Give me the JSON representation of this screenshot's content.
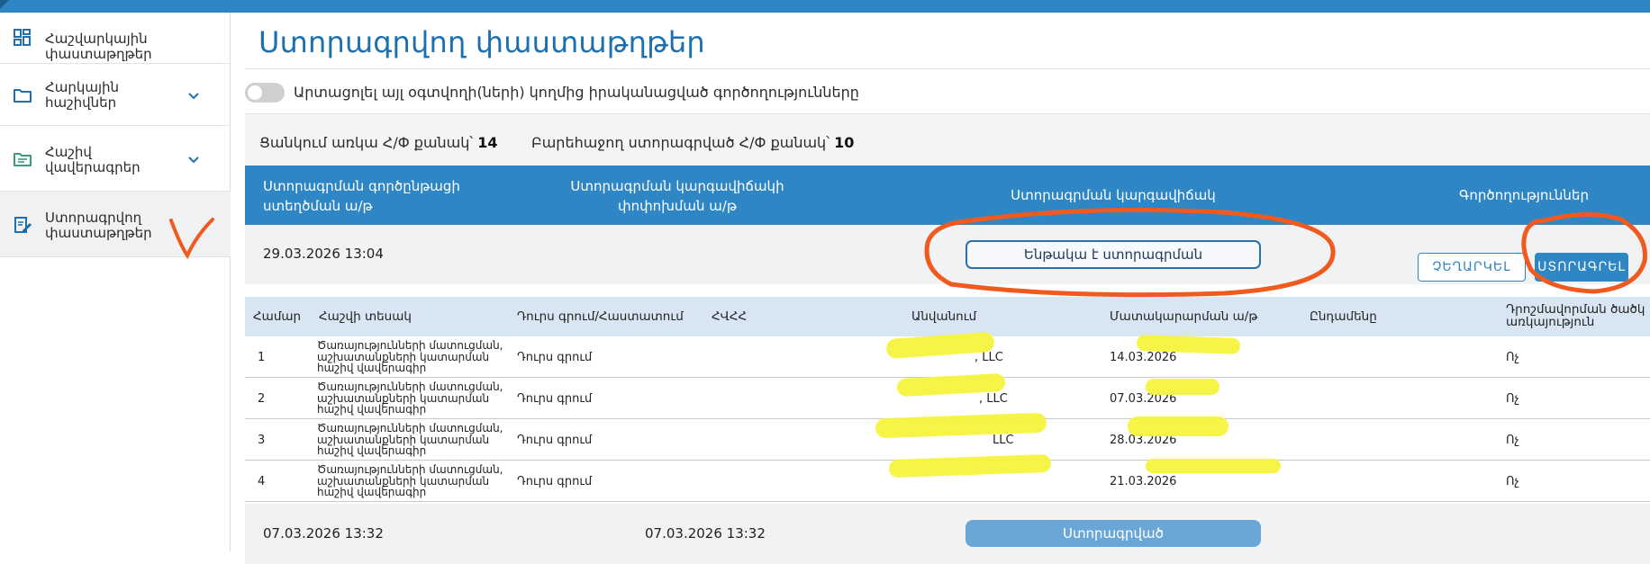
{
  "sidebar": {
    "items": [
      {
        "label": "Հաշվարկային փաստաթղթեր",
        "icon": "dashboard-icon"
      },
      {
        "label": "Հարկային հաշիվներ",
        "icon": "folder-icon"
      },
      {
        "label": "Հաշիվ վավերագրեր",
        "icon": "folder-doc-icon"
      },
      {
        "label": "Ստորագրվող փաստաթղթեր",
        "icon": "sign-doc-icon"
      }
    ]
  },
  "page": {
    "title": "Ստորագրվող փաստաթղթեր",
    "toggle_label": "Արտացոլել այլ օգտվողի(ների) կողմից իրականացված գործողությունները",
    "count_cart_label": "Ցանկում առկա Հ/Փ քանակ՝",
    "count_cart_value": "14",
    "count_signed_label": "Բարեհաջող ստորագրված Հ/Փ քանակ՝",
    "count_signed_value": "10"
  },
  "table": {
    "headers": {
      "created": "Ստորագրման գործընթացի ստեղծման ա/թ",
      "changed": "Ստորագրման կարգավիճակի փոփոխման ա/թ",
      "status": "Ստորագրման կարգավիճակ",
      "actions": "Գործողություններ"
    },
    "groups": [
      {
        "created": "29.03.2026 13:04",
        "changed": "",
        "status": "Ենթակա է ստորագրման",
        "reject_label": "ՉԵՂԱՐԿԵԼ",
        "sign_label": "ՍՏՈՐԱԳՐԵԼ"
      },
      {
        "created": "07.03.2026 13:32",
        "changed": "07.03.2026 13:32",
        "status": "Ստորագրված"
      }
    ],
    "sub_headers": {
      "number": "Համար",
      "type": "Հաշվի տեսակ",
      "direction": "Դուրս գրում/Հաստատում",
      "tin": "ՀՎՀՀ",
      "name": "Անվանում",
      "supply_date": "Մատակարարման ա/թ",
      "total": "Ընդամենը",
      "extra_line1": "Դրոշմավորման ծածկ",
      "extra_line2": "առկայություն"
    },
    "rows": [
      {
        "number": "1",
        "type": "Ծառայությունների մատուցման, աշխատանքների կատարման հաշիվ վավերագիր",
        "direction": "Դուրս գրում",
        "name": ", LLC",
        "supply_date": "14.03.2026",
        "extra": "Ոչ"
      },
      {
        "number": "2",
        "type": "Ծառայությունների մատուցման, աշխատանքների կատարման հաշիվ վավերագիր",
        "direction": "Դուրս գրում",
        "name": ", LLC",
        "supply_date": "07.03.2026",
        "extra": "Ոչ"
      },
      {
        "number": "3",
        "type": "Ծառայությունների մատուցման, աշխատանքների կատարման հաշիվ վավերագիր",
        "direction": "Դուրս գրում",
        "name": "LLC",
        "supply_date": "28.03.2026",
        "extra": "Ոչ"
      },
      {
        "number": "4",
        "type": "Ծառայությունների մատուցման, աշխատանքների կատարման հաշիվ վավերագիր",
        "direction": "Դուրս գրում",
        "name": "",
        "supply_date": "21.03.2026",
        "extra": "Ոչ"
      }
    ]
  },
  "colors": {
    "brand": "#2f86c5",
    "annotation": "#f05a1e",
    "redaction": "#f5f33c"
  }
}
